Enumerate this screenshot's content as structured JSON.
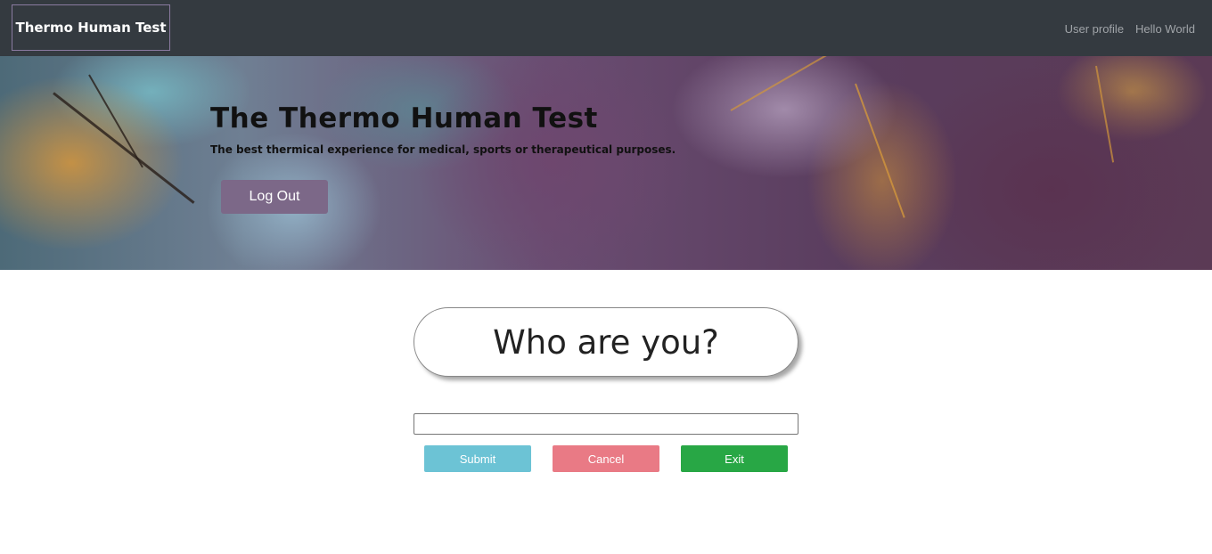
{
  "navbar": {
    "brand": "Thermo Human Test",
    "links": [
      "User profile",
      "Hello World"
    ],
    "background": "#343a40"
  },
  "hero": {
    "title": "The Thermo Human Test",
    "subtitle": "The best thermical experience for medical, sports or therapeutical purposes.",
    "logout_label": "Log Out",
    "logout_color": "#7c6888"
  },
  "form": {
    "question": "Who are you?",
    "input_value": "",
    "buttons": {
      "submit": "Submit",
      "cancel": "Cancel",
      "exit": "Exit"
    },
    "button_colors": {
      "submit": "#6cc3d5",
      "cancel": "#e97a85",
      "exit": "#28a745"
    }
  }
}
